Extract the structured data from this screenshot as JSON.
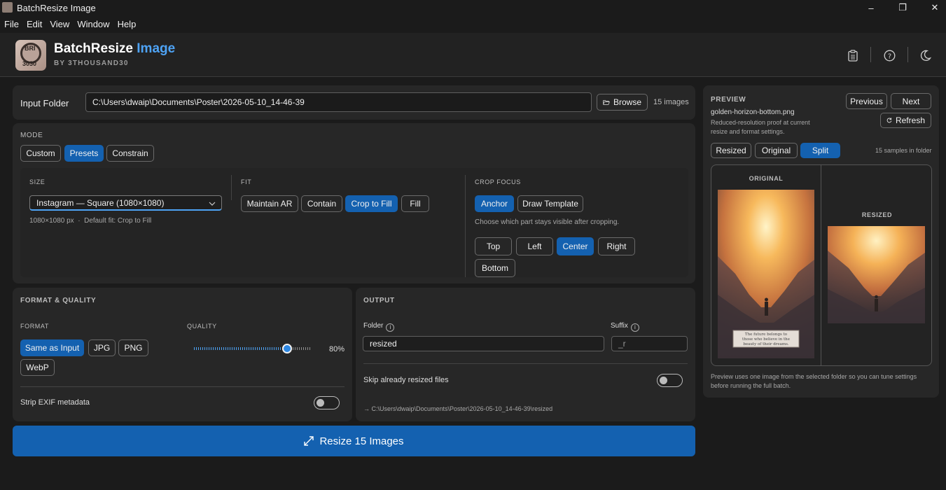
{
  "window": {
    "title": "BatchResize Image",
    "minimize": "–",
    "maximize": "❐",
    "close": "✕"
  },
  "menu": [
    "File",
    "Edit",
    "View",
    "Window",
    "Help"
  ],
  "header": {
    "logo_top": "BRI",
    "logo_bottom": "3030",
    "brand_main": "BatchResize",
    "brand_accent": "Image",
    "byline": "BY 3THOUSAND30",
    "icons": [
      "clipboard-icon",
      "help-icon",
      "theme-moon-icon"
    ]
  },
  "input": {
    "label": "Input Folder",
    "path": "C:\\Users\\dwaip\\Documents\\Poster\\2026-05-10_14-46-39",
    "browse": "Browse",
    "count": "15 images"
  },
  "mode": {
    "heading": "MODE",
    "options": [
      "Custom",
      "Presets",
      "Constrain"
    ],
    "selected": "Presets"
  },
  "size": {
    "heading": "SIZE",
    "selected": "Instagram — Square (1080×1080)",
    "hint": "1080×1080 px  ·  Default fit: Crop to Fill"
  },
  "fit": {
    "heading": "FIT",
    "options": [
      "Maintain AR",
      "Contain",
      "Crop to Fill",
      "Fill"
    ],
    "selected": "Crop to Fill"
  },
  "crop": {
    "heading": "CROP FOCUS",
    "modes": [
      "Anchor",
      "Draw Template"
    ],
    "mode_selected": "Anchor",
    "description": "Choose which part stays visible after cropping.",
    "anchors": [
      "Top",
      "Left",
      "Center",
      "Right",
      "Bottom"
    ],
    "anchor_selected": "Center"
  },
  "format_quality": {
    "heading": "FORMAT & QUALITY",
    "format_label": "FORMAT",
    "formats": [
      "Same as Input",
      "JPG",
      "PNG",
      "WebP"
    ],
    "format_selected": "Same as Input",
    "quality_label": "QUALITY",
    "quality": 80,
    "quality_text": "80%",
    "strip_exif_label": "Strip EXIF metadata",
    "strip_exif": false
  },
  "output": {
    "heading": "OUTPUT",
    "folder_label": "Folder",
    "folder": "resized",
    "suffix_label": "Suffix",
    "suffix_placeholder": "_r",
    "skip_label": "Skip already resized files",
    "skip": false,
    "dest": "→ C:\\Users\\dwaip\\Documents\\Poster\\2026-05-10_14-46-39\\resized"
  },
  "action": {
    "label": "Resize 15 Images",
    "icon": "expand-arrows-icon"
  },
  "preview": {
    "heading": "PREVIEW",
    "filename": "golden-horizon-bottom.png",
    "desc_line1": "Reduced-resolution proof at current",
    "desc_line2": "resize and format settings.",
    "previous": "Previous",
    "next": "Next",
    "refresh": "Refresh",
    "views": [
      "Resized",
      "Original",
      "Split"
    ],
    "view_selected": "Split",
    "samples": "15 samples in folder",
    "original_label": "ORIGINAL",
    "resized_label": "RESIZED",
    "caption": [
      "The future belongs to",
      "those who believe in the",
      "beauty of their dreams."
    ],
    "footer_line1": "Preview uses one image from the selected folder so you can tune settings",
    "footer_line2": "before running the full batch."
  },
  "colors": {
    "accent": "#1461b0",
    "brand_accent": "#4ea3f5",
    "background": "#1b1b1b",
    "panel": "#272727"
  }
}
